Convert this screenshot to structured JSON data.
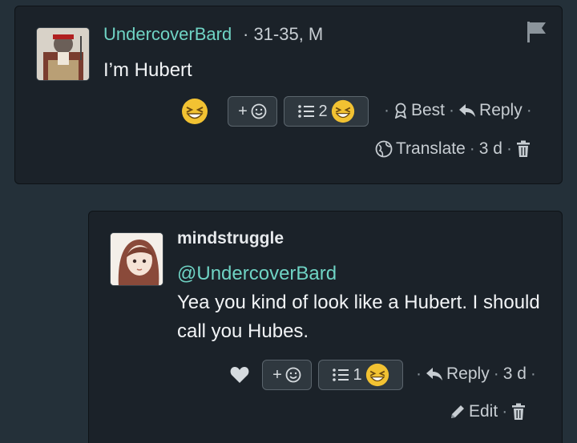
{
  "comments": [
    {
      "username": "UndercoverBard",
      "meta": "· 31-35, M",
      "text": "I’m Hubert",
      "react_add": "+",
      "list_count": "2",
      "actions": {
        "best": "Best",
        "reply": "Reply",
        "translate": "Translate",
        "age": "3 d"
      }
    },
    {
      "username": "mindstruggle",
      "mention": "@UndercoverBard",
      "text": "Yea you kind of look like a Hubert. I should call you Hubes.",
      "react_add": "+",
      "list_count": "1",
      "actions": {
        "reply": "Reply",
        "age": "3 d",
        "edit": "Edit"
      }
    }
  ],
  "colors": {
    "accent": "#6fd3c4",
    "background": "#243039",
    "card": "#1b2229"
  }
}
